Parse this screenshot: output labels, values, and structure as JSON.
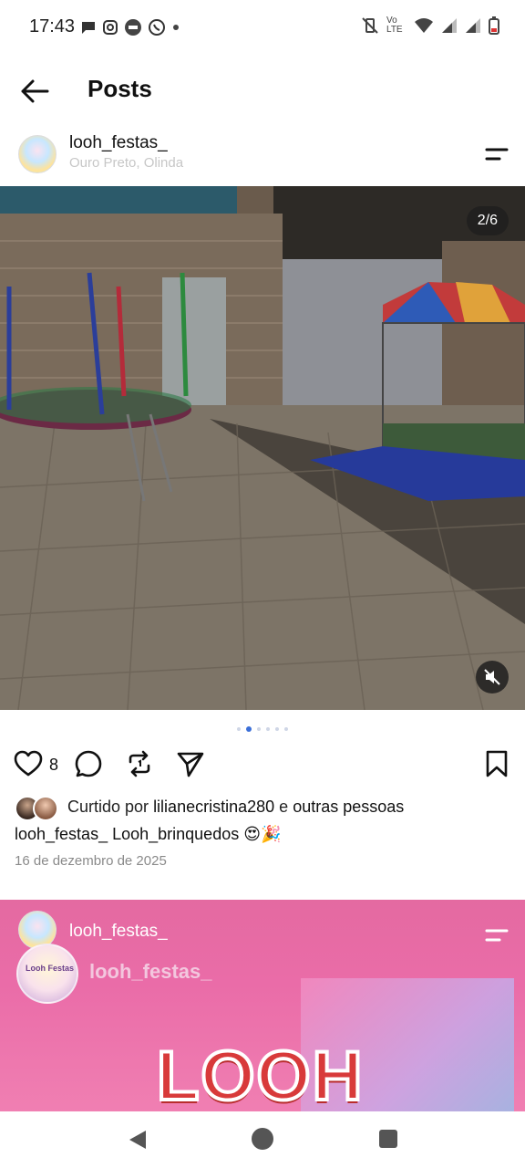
{
  "status_bar": {
    "time": "17:43",
    "left_icons": [
      "message-icon",
      "instagram-icon",
      "app-badge-icon",
      "whatsapp-icon",
      "dot-icon"
    ],
    "right_icons": [
      "vibrate-off-icon",
      "volte-icon",
      "wifi-icon",
      "signal-icon",
      "signal-icon",
      "battery-icon"
    ],
    "volte_label": "Vo LTE"
  },
  "header": {
    "title": "Posts"
  },
  "post1": {
    "username": "looh_festas_",
    "location": "Ouro Preto, Olinda",
    "media_counter": "2/6",
    "like_count": "8",
    "carousel": {
      "total": 6,
      "active_index": 1
    },
    "liked_by_prefix": "Curtido por",
    "liked_by_user": "lilianecristina280",
    "liked_by_suffix": "e",
    "liked_by_others": "outras pessoas",
    "caption_user": "looh_festas_",
    "caption_text": "Looh_brinquedos 😍🎉",
    "date": "16 de dezembro de 2025"
  },
  "post2": {
    "username": "looh_festas_",
    "inner_name": "looh_festas_",
    "inner_avatar_text": "Looh Festas",
    "logo_text": "LOOH"
  },
  "colors": {
    "accent_blue": "#3b6fd8",
    "post2_pink": "#e96aa5",
    "logo_red": "#d83a3a"
  }
}
